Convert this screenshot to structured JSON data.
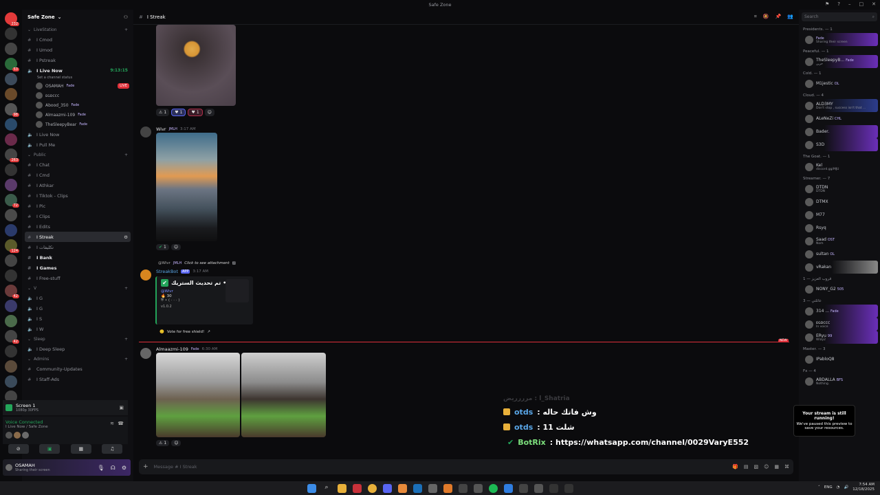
{
  "window": {
    "title": "Safe Zone"
  },
  "guild": {
    "name": "Safe Zone"
  },
  "server_rail": {
    "badges": [
      "232",
      "53",
      "98",
      "263",
      "72",
      "124",
      "42",
      "42"
    ]
  },
  "channels": [
    {
      "type": "cat",
      "label": "LiveStation"
    },
    {
      "type": "text",
      "label": "I Cmod"
    },
    {
      "type": "text",
      "label": "I Umod"
    },
    {
      "type": "text",
      "label": "I Pstreak"
    },
    {
      "type": "voice",
      "label": "I Live Now",
      "bold": true,
      "time": "9:13:15",
      "status": "Set a channel status"
    },
    {
      "type": "vuser",
      "label": "OSAMAH",
      "tag": "Fade",
      "live": "LIVE"
    },
    {
      "type": "vuser",
      "label": "ᴇɢᴅᴄᴄᴄ"
    },
    {
      "type": "vuser",
      "label": "Abood_350",
      "tag": "Fade"
    },
    {
      "type": "vuser",
      "label": "Almaazmi-109",
      "tag": "Fade"
    },
    {
      "type": "vuser",
      "label": "TheSleepyBear",
      "tag": "Fade"
    },
    {
      "type": "voice",
      "label": "I Live Now"
    },
    {
      "type": "voice",
      "label": "I Pull Me"
    },
    {
      "type": "cat",
      "label": "Public"
    },
    {
      "type": "text",
      "label": "I Chat"
    },
    {
      "type": "text",
      "label": "I Cmd"
    },
    {
      "type": "text",
      "label": "I Athkar"
    },
    {
      "type": "text",
      "label": "I Tiktok - Clips"
    },
    {
      "type": "text",
      "label": "I Pic"
    },
    {
      "type": "text",
      "label": "I Clips"
    },
    {
      "type": "text",
      "label": "I Edits"
    },
    {
      "type": "text",
      "label": "I Streak",
      "active": true
    },
    {
      "type": "text",
      "label": "I تكليفات"
    },
    {
      "type": "text",
      "label": "I Bank",
      "bold": true
    },
    {
      "type": "text",
      "label": "I Games",
      "bold": true
    },
    {
      "type": "text",
      "label": "I Free-stuff"
    },
    {
      "type": "cat",
      "label": "V"
    },
    {
      "type": "voice",
      "label": "I G"
    },
    {
      "type": "voice",
      "label": "I G"
    },
    {
      "type": "voice",
      "label": "I S"
    },
    {
      "type": "voice",
      "label": "I W"
    },
    {
      "type": "cat",
      "label": "Sleep"
    },
    {
      "type": "voice",
      "label": "I Deep Sleep"
    },
    {
      "type": "cat",
      "label": "Admins"
    },
    {
      "type": "text",
      "label": "Community-Updates"
    },
    {
      "type": "text",
      "label": "I Staff-Ads"
    }
  ],
  "screen": {
    "title": "Screen 1",
    "sub": "1080p 30FPS"
  },
  "voice_connected": {
    "title": "Voice Connected",
    "sub": "I Live Now / Safe Zone"
  },
  "user": {
    "name": "OSAMAH",
    "status": "Sharing their screen"
  },
  "header": {
    "channel": "I Streak"
  },
  "messages": {
    "m1_reacts": [
      "1",
      "1",
      "1"
    ],
    "m2_author": "Wivr",
    "m2_tag": "JMLH",
    "m2_time": "3:17 AM",
    "m2_react": "1",
    "bot_reply_user": "@Wivr",
    "bot_reply_tag": "JMLH",
    "bot_reply_text": "Click to see attachment",
    "bot_name": "StreakBot",
    "bot_app": "APP",
    "bot_time": "3:17 AM",
    "embed_title": "تم تحديث الستريك •",
    "embed_mention": "@Wivr",
    "embed_count": "30",
    "embed_version": "v1.0.2",
    "vote_link": "Vote for free shield!",
    "new_tag": "NEW",
    "m3_author": "Almaazmi-109",
    "m3_tag": "Fade",
    "m3_time": "6:30 AM",
    "m3_react": "1"
  },
  "overlay": {
    "faint": "مرررريض : l_Shatria",
    "lines": [
      {
        "user": "otds",
        "text": ": وش فاتك حاله"
      },
      {
        "user": "otds",
        "text": ": شلت 11"
      },
      {
        "user": "BotRix",
        "text": ": https://whatsapp.com/channel/0029VaryE552"
      }
    ]
  },
  "composer": {
    "placeholder": "Message # I Streak"
  },
  "search": {
    "placeholder": "Search"
  },
  "member_groups": [
    {
      "label": "Presidents. — 1",
      "members": [
        {
          "name": "",
          "sub": "Sharing their screen",
          "tag": "Fade",
          "style": "purple"
        }
      ]
    },
    {
      "label": "Peaceful. — 1",
      "members": [
        {
          "name": "TheSleepyB...",
          "sub": "حزين",
          "tag": "Fade",
          "style": "purple"
        }
      ]
    },
    {
      "label": "Cold. — 1",
      "members": [
        {
          "name": "M1jestic",
          "sub": "",
          "tag": "OL",
          "style": ""
        }
      ]
    },
    {
      "label": "Cloud. — 4",
      "members": [
        {
          "name": "ALD3MY",
          "sub": "Don't stop , success isn't that ...",
          "tag": "",
          "style": "blue"
        },
        {
          "name": "ALeNeZi",
          "sub": "",
          "tag": "CHL",
          "style": ""
        },
        {
          "name": "Bader.",
          "sub": "",
          "tag": "",
          "style": "purple"
        },
        {
          "name": "S3D",
          "sub": "",
          "tag": "",
          "style": "purple"
        }
      ]
    },
    {
      "label": "The Goat. — 1",
      "members": [
        {
          "name": "Kel",
          "sub": "discord.gg/MJU",
          "tag": "",
          "style": ""
        }
      ]
    },
    {
      "label": "Streamer. — 7",
      "members": [
        {
          "name": "DTDN",
          "sub": "DTDN",
          "tag": "",
          "style": ""
        },
        {
          "name": "DTMX",
          "sub": "",
          "tag": "",
          "style": ""
        },
        {
          "name": "M77",
          "sub": "",
          "tag": "",
          "style": ""
        },
        {
          "name": "Rsyq",
          "sub": "",
          "tag": "",
          "style": ""
        },
        {
          "name": "Saad",
          "sub": "Nom",
          "tag": "OST",
          "style": ""
        },
        {
          "name": "sultan",
          "sub": "",
          "tag": "OL",
          "style": ""
        },
        {
          "name": "vRakan",
          "sub": "",
          "tag": "",
          "style": "grey"
        }
      ]
    },
    {
      "label": "قروب العزيز — 1",
      "members": [
        {
          "name": "NONY_G2",
          "sub": "",
          "tag": "505",
          "style": ""
        }
      ]
    },
    {
      "label": "عائلتي — 3",
      "members": [
        {
          "name": "314 ...",
          "sub": "",
          "tag": "Fade",
          "style": "purple"
        },
        {
          "name": "ᴇɢᴅᴄᴄᴄ",
          "sub": "In voice",
          "tag": "",
          "style": "purple"
        },
        {
          "name": "ERyu",
          "sub": "Wlay2",
          "tag": "99",
          "style": "purple"
        }
      ]
    },
    {
      "label": "Master. — 3",
      "members": [
        {
          "name": "IPabloQ8",
          "sub": "",
          "tag": "",
          "style": ""
        }
      ]
    },
    {
      "label": "Fx — 4",
      "members": [
        {
          "name": "ABDALLA",
          "sub": "Nothing.",
          "tag": "BFS",
          "style": ""
        }
      ]
    }
  ],
  "stream_popup": {
    "title": "Your stream is still running!",
    "body": "We've paused this preview to save your resources."
  },
  "taskbar": {
    "lang": "ENG",
    "time": "7:54 AM",
    "date": "12/18/2025"
  },
  "colors": {
    "accent": "#5865f2",
    "green": "#23a55a",
    "red": "#e0303a"
  }
}
